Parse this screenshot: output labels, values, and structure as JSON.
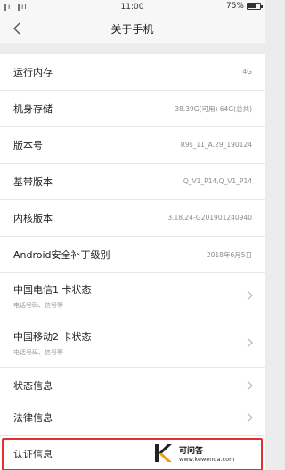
{
  "status_bar": {
    "signal": "‖ıl ‖ıl",
    "time": "11:00",
    "battery_text": "75%",
    "battery_level": 0.75
  },
  "header": {
    "back_glyph": "〈",
    "title": "关于手机"
  },
  "items": [
    {
      "label": "运行内存",
      "value": "4G"
    },
    {
      "label": "机身存储",
      "value": "38.39G(可用)  64G(总共)"
    },
    {
      "label": "版本号",
      "value": "R9s_11_A.29_190124"
    },
    {
      "label": "基带版本",
      "value": "Q_V1_P14,Q_V1_P14"
    },
    {
      "label": "内核版本",
      "value": "3.18.24-G201901240940"
    },
    {
      "label": "Android安全补丁级别",
      "value": "2018年6月5日"
    },
    {
      "label": "中国电信1 卡状态",
      "sub": "电话号码、信号等"
    },
    {
      "label": "中国移动2 卡状态",
      "sub": "电话号码、信号等"
    },
    {
      "label": "状态信息"
    }
  ],
  "items2": [
    {
      "label": "法律信息"
    },
    {
      "label": "认证信息"
    }
  ],
  "watermark": {
    "name": "可问答",
    "url": "www.kewenda.com"
  },
  "colors": {
    "background": "#ececec",
    "highlight": "#e03030",
    "logo_orange": "#f39c12"
  }
}
